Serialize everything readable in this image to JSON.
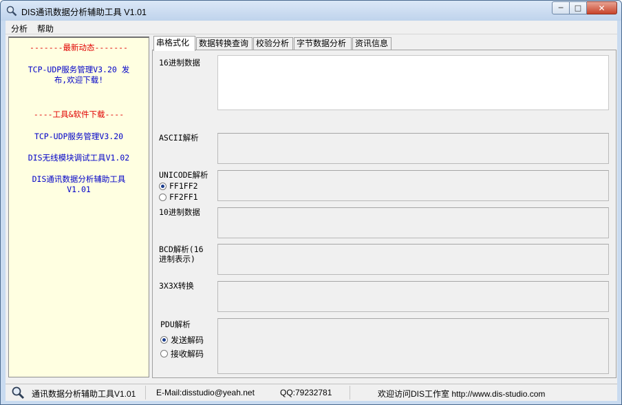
{
  "window": {
    "title": "DIS通讯数据分析辅助工具 V1.01",
    "min_label": "─",
    "max_label": "□",
    "close_label": "✕"
  },
  "menu": {
    "items": [
      "分析",
      "帮助"
    ]
  },
  "left_panel": {
    "news_header": "-------最新动态-------",
    "news_line1": "TCP-UDP服务管理V3.20 发",
    "news_line2": "布,欢迎下载!",
    "tools_header": "----工具&软件下载----",
    "tool1": "TCP-UDP服务管理V3.20",
    "tool2": "DIS无线模块调试工具V1.02",
    "tool3_line1": "DIS通讯数据分析辅助工具",
    "tool3_line2": "V1.01"
  },
  "tabs": [
    "串格式化",
    "数据转换查询",
    "校验分析",
    "字节数据分析",
    "资讯信息"
  ],
  "active_tab": 0,
  "fields": {
    "hex_label": "16进制数据",
    "ascii_label": "ASCII解析",
    "unicode_label": "UNICODE解析",
    "unicode_opt1": "FF1FF2",
    "unicode_opt2": "FF2FF1",
    "dec_label": "10进制数据",
    "bcd_label_line1": "BCD解析(16",
    "bcd_label_line2": "进制表示)",
    "x3x_label": "3X3X转换",
    "pdu_label": "PDU解析",
    "pdu_opt1": "发送解码",
    "pdu_opt2": "接收解码"
  },
  "statusbar": {
    "app": "通讯数据分析辅助工具V1.01",
    "email": "E-Mail:disstudio@yeah.net",
    "qq": "QQ:79232781",
    "site": "欢迎访问DIS工作室 http://www.dis-studio.com"
  }
}
